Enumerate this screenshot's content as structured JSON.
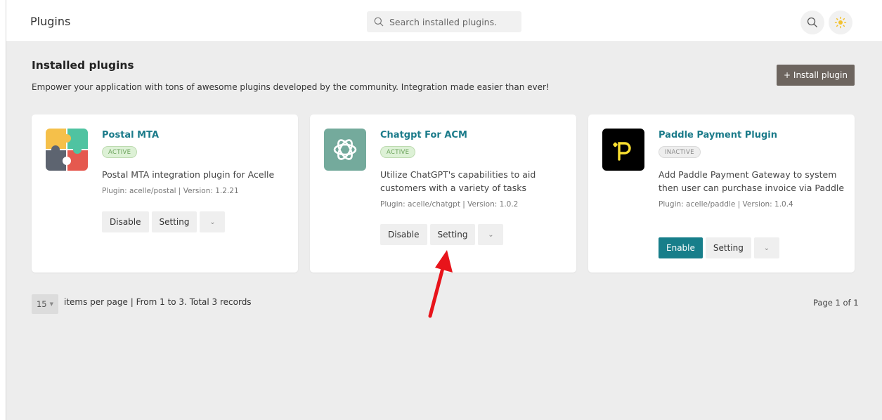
{
  "header": {
    "title": "Plugins",
    "search_placeholder": "Search installed plugins."
  },
  "main": {
    "heading": "Installed plugins",
    "subheading": "Empower your application with tons of awesome plugins developed by the community. Integration made easier than ever!",
    "install_button": "+ Install plugin"
  },
  "plugins": [
    {
      "name": "Postal MTA",
      "status": "ACTIVE",
      "description": "Postal MTA integration plugin for Acelle",
      "meta": "Plugin: acelle/postal | Version: 1.2.21",
      "primary_button": "Disable",
      "setting_button": "Setting",
      "caret": "⌄"
    },
    {
      "name": "Chatgpt For ACM",
      "status": "ACTIVE",
      "description": "Utilize ChatGPT's capabilities to aid customers with a variety of tasks",
      "meta": "Plugin: acelle/chatgpt | Version: 1.0.2",
      "primary_button": "Disable",
      "setting_button": "Setting",
      "caret": "⌄"
    },
    {
      "name": "Paddle Payment Plugin",
      "status": "INACTIVE",
      "description": "Add Paddle Payment Gateway to system then user can purchase invoice via Paddle",
      "meta": "Plugin: acelle/paddle | Version: 1.0.4",
      "primary_button": "Enable",
      "setting_button": "Setting",
      "caret": "⌄"
    }
  ],
  "pagination": {
    "per_page": "15",
    "summary": "items per page  | From 1 to 3. Total 3 records",
    "page": "Page 1 of 1"
  },
  "colors": {
    "accent": "#177e8a",
    "arrow": "#e8141b"
  }
}
